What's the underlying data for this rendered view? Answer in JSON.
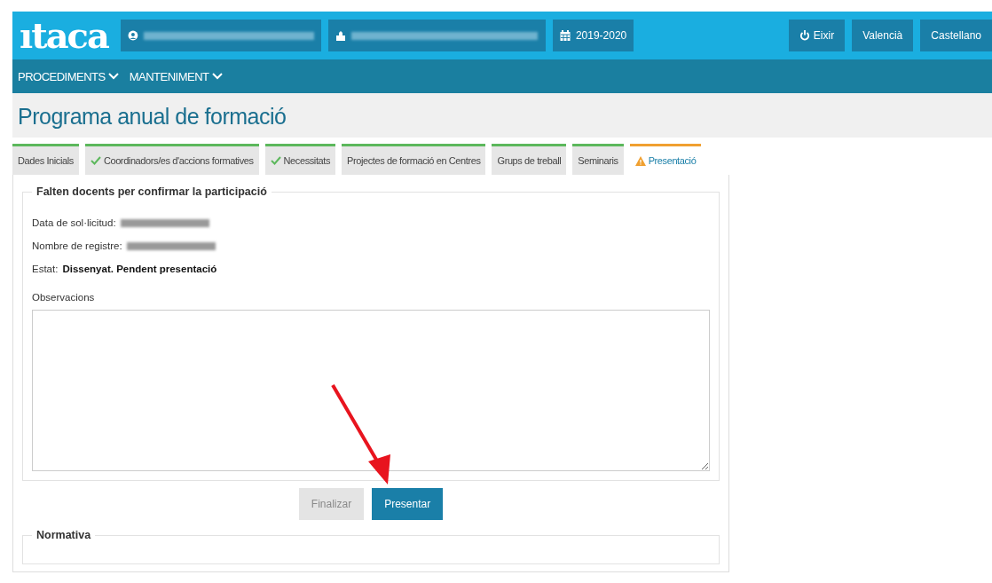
{
  "header": {
    "logo": "ıtaca",
    "year": "2019-2020",
    "buttons": [
      {
        "label": "Eixir"
      },
      {
        "label": "Valencià"
      },
      {
        "label": "Castellano"
      }
    ]
  },
  "nav": [
    {
      "label": "PROCEDIMENTS"
    },
    {
      "label": "MANTENIMENT"
    }
  ],
  "page_title": "Programa anual de formació",
  "tabs": [
    {
      "label": "Dades Inicials",
      "kind": "plain",
      "selected": false
    },
    {
      "label": "Coordinadors/es d'accions formatives",
      "kind": "done",
      "selected": false
    },
    {
      "label": "Necessitats",
      "kind": "done",
      "selected": false
    },
    {
      "label": "Projectes de formació en Centres",
      "kind": "plain",
      "selected": false
    },
    {
      "label": "Grups de treball",
      "kind": "plain",
      "selected": false
    },
    {
      "label": "Seminaris",
      "kind": "plain",
      "selected": false
    },
    {
      "label": "Presentació",
      "kind": "warning",
      "selected": true
    }
  ],
  "section": {
    "legend": "Falten docents per confirmar la participació",
    "fields": [
      {
        "label": "Data de sol·licitud:",
        "value_blurred": true
      },
      {
        "label": "Nombre de registre:",
        "value_blurred": true
      },
      {
        "label": "Estat:",
        "value": "Dissenyat. Pendent presentació"
      }
    ],
    "observations_label": "Observacions"
  },
  "buttons": [
    {
      "label": "Finalizar",
      "disabled": true
    },
    {
      "label": "Presentar",
      "disabled": false
    }
  ],
  "normativa": {
    "legend": "Normativa"
  }
}
